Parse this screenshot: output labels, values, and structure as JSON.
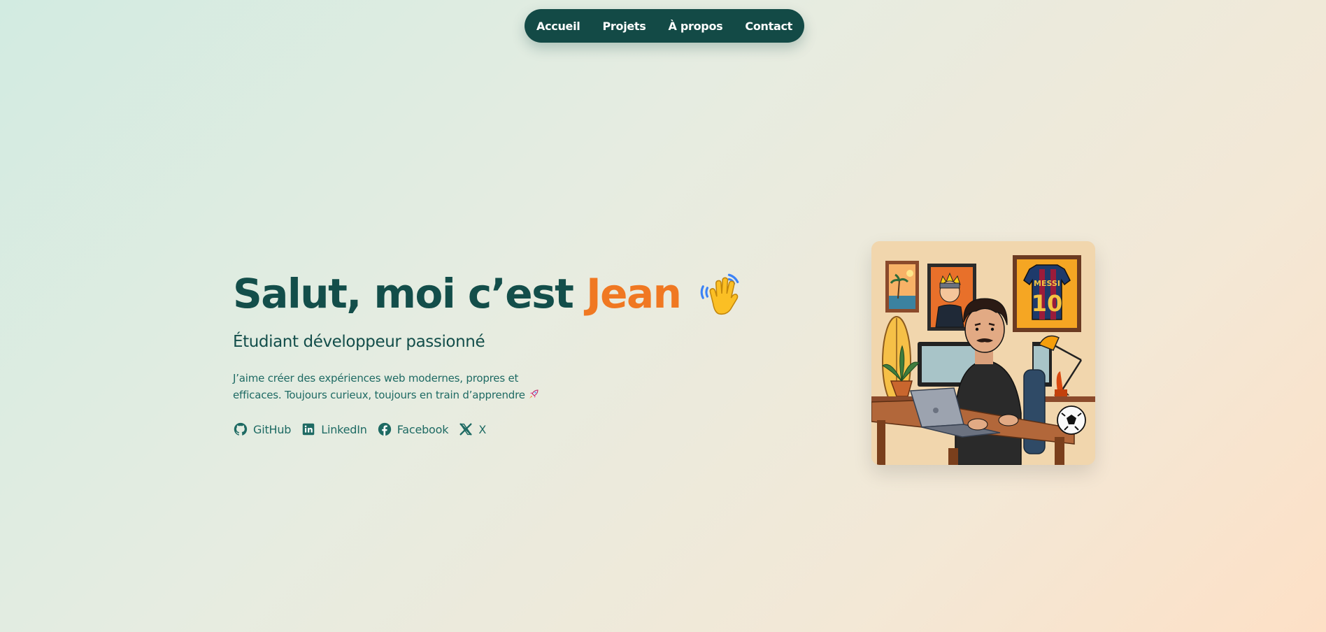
{
  "nav": {
    "items": [
      {
        "label": "Accueil"
      },
      {
        "label": "Projets"
      },
      {
        "label": "À propos"
      },
      {
        "label": "Contact"
      }
    ]
  },
  "hero": {
    "greeting": "Salut, moi c’est ",
    "name": "Jean",
    "subtitle": "Étudiant développeur passionné",
    "description": "J’aime créer des expériences web modernes, propres et efficaces. Toujours curieux, toujours en train d’apprendre",
    "wave_icon": "waving-hand-icon",
    "rocket_icon": "rocket-icon"
  },
  "socials": [
    {
      "label": "GitHub",
      "icon": "github-icon"
    },
    {
      "label": "LinkedIn",
      "icon": "linkedin-icon"
    },
    {
      "label": "Facebook",
      "icon": "facebook-icon"
    },
    {
      "label": "X",
      "icon": "x-icon"
    }
  ],
  "illustration": {
    "jersey_name": "MESSI",
    "jersey_number": "10"
  },
  "colors": {
    "primary": "#134e4a",
    "accent": "#f07822",
    "nav_bg": "#134a46"
  }
}
